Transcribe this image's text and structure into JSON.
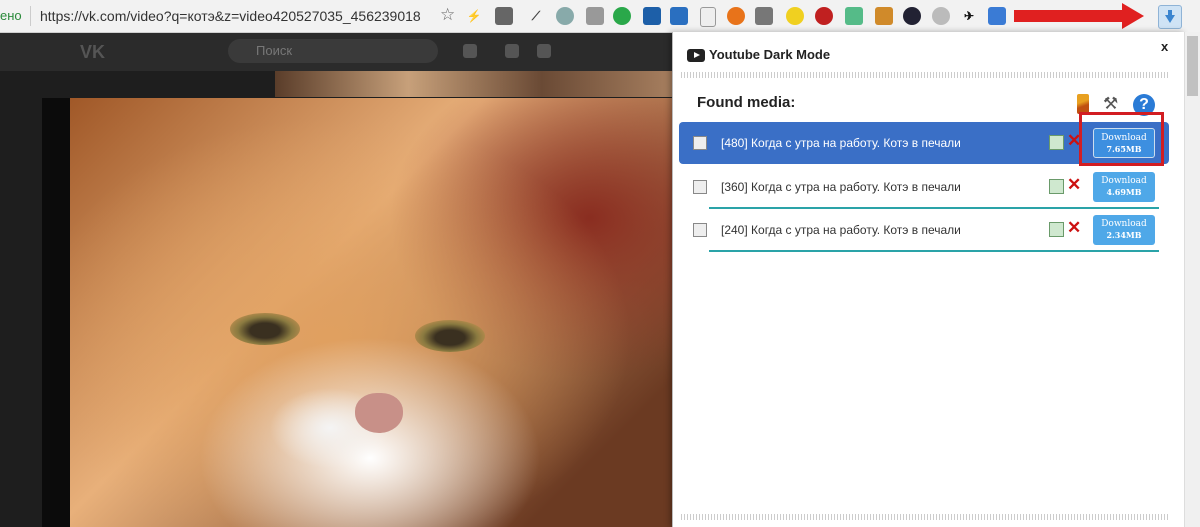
{
  "browser": {
    "secure_label": "ено",
    "url": "https://vk.com/video?q=котэ&z=video420527035_456239018"
  },
  "vk": {
    "logo": "VK",
    "search_placeholder": "Поиск"
  },
  "popup": {
    "title": "Youtube Dark Mode",
    "close": "x",
    "found_media": "Found media:",
    "help": "?",
    "items": [
      {
        "label": "[480] Когда с утра на работу. Котэ в печали",
        "download": "Download",
        "size": "7.65MB",
        "selected": true
      },
      {
        "label": "[360] Когда с утра на работу. Котэ в печали",
        "download": "Download",
        "size": "4.69MB",
        "selected": false
      },
      {
        "label": "[240] Когда с утра на работу. Котэ в печали",
        "download": "Download",
        "size": "2.34MB",
        "selected": false
      }
    ],
    "delete_glyph": "✕"
  },
  "colors": {
    "highlight": "#d21d22",
    "accent": "#3a6fc6"
  }
}
